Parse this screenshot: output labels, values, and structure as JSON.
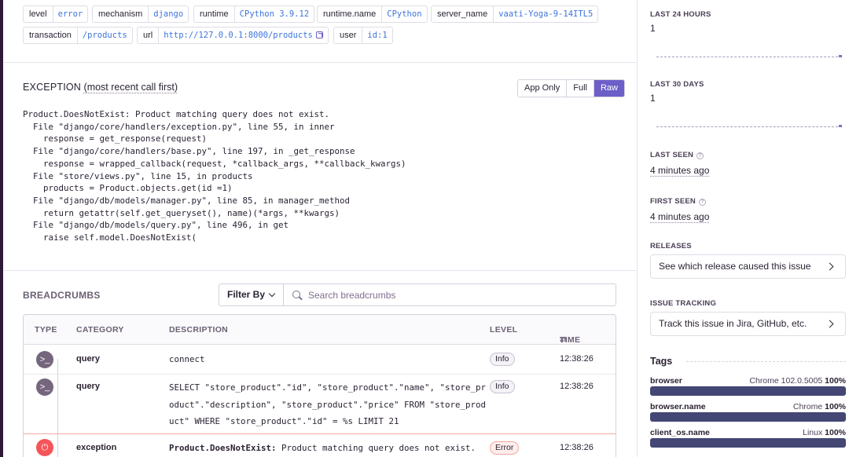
{
  "event_tags": [
    {
      "key": "level",
      "value": "error"
    },
    {
      "key": "mechanism",
      "value": "django"
    },
    {
      "key": "runtime",
      "value": "CPython 3.9.12"
    },
    {
      "key": "runtime.name",
      "value": "CPython"
    },
    {
      "key": "server_name",
      "value": "vaati-Yoga-9-14ITL5"
    },
    {
      "key": "transaction",
      "value": "/products"
    },
    {
      "key": "url",
      "value": "http://127.0.0.1:8000/products"
    },
    {
      "key": "user",
      "value": "id:1"
    }
  ],
  "exception": {
    "heading": "EXCEPTION",
    "subheading": "(most recent call first)",
    "toggle": [
      "App Only",
      "Full",
      "Raw"
    ],
    "active_toggle": "Raw",
    "raw_trace": "Product.DoesNotExist: Product matching query does not exist.\n  File \"django/core/handlers/exception.py\", line 55, in inner\n    response = get_response(request)\n  File \"django/core/handlers/base.py\", line 197, in _get_response\n    response = wrapped_callback(request, *callback_args, **callback_kwargs)\n  File \"store/views.py\", line 15, in products\n    products = Product.objects.get(id =1)\n  File \"django/db/models/manager.py\", line 85, in manager_method\n    return getattr(self.get_queryset(), name)(*args, **kwargs)\n  File \"django/db/models/query.py\", line 496, in get\n    raise self.model.DoesNotExist("
  },
  "breadcrumbs": {
    "heading": "BREADCRUMBS",
    "filter_label": "Filter By",
    "search_placeholder": "Search breadcrumbs",
    "columns": {
      "type": "TYPE",
      "category": "CATEGORY",
      "description": "DESCRIPTION",
      "level": "LEVEL",
      "time": "TIME"
    },
    "rows": [
      {
        "type_icon": "terminal-icon",
        "category": "query",
        "description": "connect",
        "level": "Info",
        "time": "12:38:26"
      },
      {
        "type_icon": "terminal-icon",
        "category": "query",
        "description": "SELECT \"store_product\".\"id\", \"store_product\".\"name\", \"store_pr\noduct\".\"description\", \"store_product\".\"price\" FROM \"store_prod\nuct\" WHERE \"store_product\".\"id\" = %s LIMIT 21",
        "level": "Info",
        "time": "12:38:26"
      },
      {
        "type_icon": "power-icon",
        "category": "exception",
        "description_bold": "Product.DoesNotExist:",
        "description": " Product matching query does not exist.",
        "level": "Error",
        "time": "12:38:26"
      }
    ]
  },
  "sidebar": {
    "last24_label": "LAST 24 HOURS",
    "last24_value": "1",
    "last30_label": "LAST 30 DAYS",
    "last30_value": "1",
    "last_seen_label": "LAST SEEN",
    "last_seen_value": "4 minutes ago",
    "first_seen_label": "FIRST SEEN",
    "first_seen_value": "4 minutes ago",
    "releases_label": "RELEASES",
    "releases_link": "See which release caused this issue",
    "issue_tracking_label": "ISSUE TRACKING",
    "issue_tracking_link": "Track this issue in Jira, GitHub, etc.",
    "tags_heading": "Tags",
    "tag_stats": [
      {
        "name": "browser",
        "top": "Chrome 102.0.5005",
        "pct": "100%"
      },
      {
        "name": "browser.name",
        "top": "Chrome",
        "pct": "100%"
      },
      {
        "name": "client_os.name",
        "top": "Linux",
        "pct": "100%"
      }
    ]
  },
  "colors": {
    "accent": "#6c5fc7",
    "link": "#3d74db",
    "error": "#f55459",
    "tag_bar": "#444674"
  }
}
